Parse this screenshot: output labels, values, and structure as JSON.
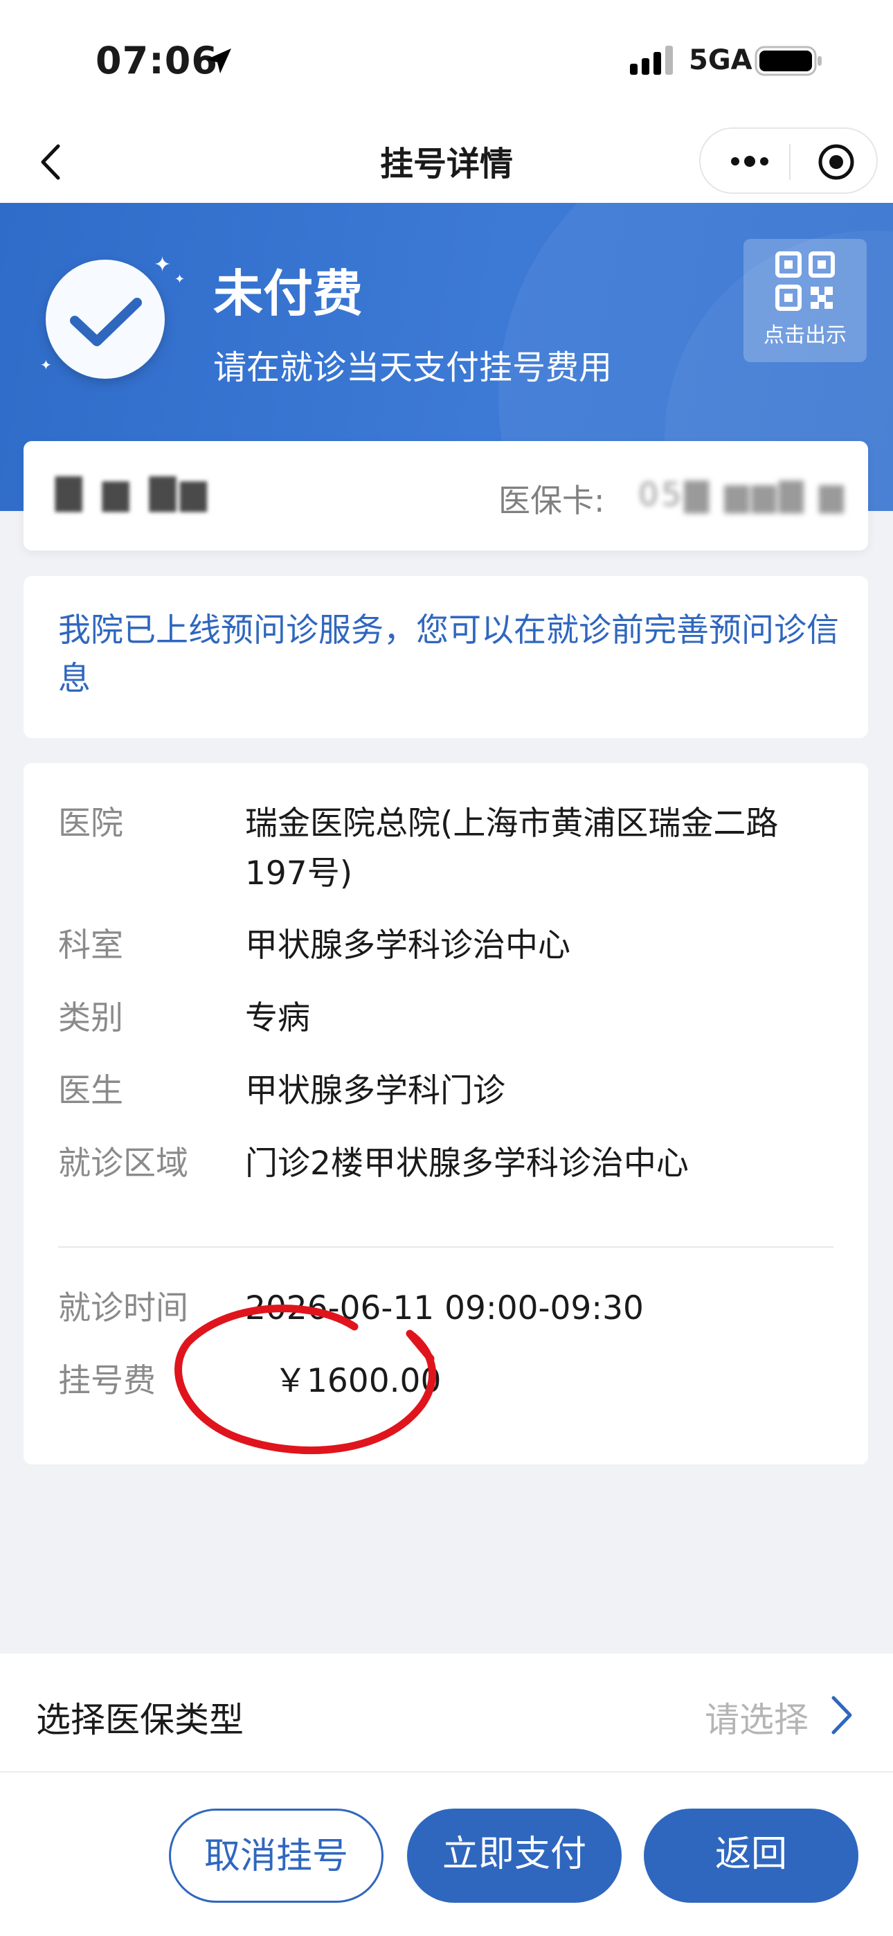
{
  "status_bar": {
    "time": "07:06",
    "network": "5GA"
  },
  "nav": {
    "title": "挂号详情"
  },
  "banner": {
    "status": "未付费",
    "subtitle": "请在就诊当天支付挂号费用",
    "qr_label": "点击出示"
  },
  "patient": {
    "name": "▇ ▆ ▇▆",
    "insurance_label": "医保卡:",
    "insurance_value": "05▇ ▆▆▇ ▆"
  },
  "notice": {
    "text": "我院已上线预问诊服务，您可以在就诊前完善预问诊信息"
  },
  "details": [
    {
      "key": "医院",
      "value": "瑞金医院总院(上海市黄浦区瑞金二路197号)"
    },
    {
      "key": "科室",
      "value": "甲状腺多学科诊治中心"
    },
    {
      "key": "类别",
      "value": "专病"
    },
    {
      "key": "医生",
      "value": "甲状腺多学科门诊"
    },
    {
      "key": "就诊区域",
      "value": "门诊2楼甲状腺多学科诊治中心"
    }
  ],
  "appointment": {
    "time_key": "就诊时间",
    "time_value": "2026-06-11 09:00-09:30",
    "fee_key": "挂号费",
    "fee_value": "￥1600.00"
  },
  "insurance_type": {
    "label": "选择医保类型",
    "placeholder": "请选择"
  },
  "buttons": {
    "cancel": "取消挂号",
    "pay": "立即支付",
    "back": "返回"
  },
  "colors": {
    "primary": "#2f67bf",
    "banner": "#3d7ad6",
    "annotation": "#e0141c"
  }
}
